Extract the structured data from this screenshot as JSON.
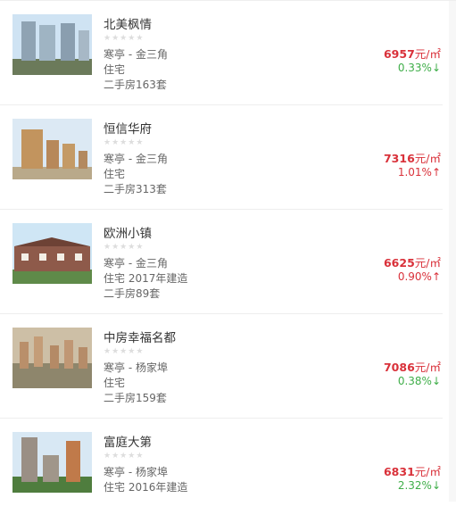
{
  "listings": [
    {
      "name": "北美枫情",
      "location": "寒亭 - 金三角",
      "type_line": "住宅",
      "resale": "二手房163套",
      "price": "6957",
      "unit": "元/㎡",
      "change": "0.33%",
      "direction": "down",
      "arrow": "↓",
      "rating": "0 of 5"
    },
    {
      "name": "恒信华府",
      "location": "寒亭 - 金三角",
      "type_line": "住宅",
      "resale": "二手房313套",
      "price": "7316",
      "unit": "元/㎡",
      "change": "1.01%",
      "direction": "up",
      "arrow": "↑",
      "rating": "0 of 5"
    },
    {
      "name": "欧洲小镇",
      "location": "寒亭 - 金三角",
      "type_line": "住宅 2017年建造",
      "resale": "二手房89套",
      "price": "6625",
      "unit": "元/㎡",
      "change": "0.90%",
      "direction": "up",
      "arrow": "↑",
      "rating": "0 of 5"
    },
    {
      "name": "中房幸福名都",
      "location": "寒亭 - 杨家埠",
      "type_line": "住宅",
      "resale": "二手房159套",
      "price": "7086",
      "unit": "元/㎡",
      "change": "0.38%",
      "direction": "down",
      "arrow": "↓",
      "rating": "0 of 5"
    },
    {
      "name": "富庭大第",
      "location": "寒亭 - 杨家埠",
      "type_line": "住宅 2016年建造",
      "resale": "",
      "price": "6831",
      "unit": "元/㎡",
      "change": "2.32%",
      "direction": "down",
      "arrow": "↓",
      "rating": "0 of 5"
    }
  ],
  "colors": {
    "price": "#d9313a",
    "down": "#3fae49",
    "up": "#d9313a",
    "star": "#dddddd"
  },
  "icons": {
    "star": "star-icon",
    "arrow_up": "arrow-up-icon",
    "arrow_down": "arrow-down-icon"
  }
}
